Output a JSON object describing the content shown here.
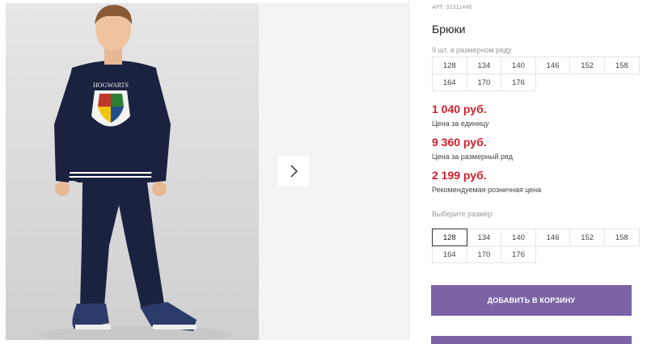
{
  "gallery": {
    "photo_alt": "",
    "sweatshirt_print": "HOGWARTS",
    "next_icon": "chevron-right-icon"
  },
  "product": {
    "article": "АРТ. 32311446",
    "title": "Брюки",
    "range_note": "9 шт. в размерном ряду",
    "range_sizes": [
      "128",
      "134",
      "140",
      "146",
      "152",
      "158",
      "164",
      "170",
      "176"
    ],
    "prices": [
      {
        "value": "1 040 руб.",
        "label": "Цена за единицу"
      },
      {
        "value": "9 360 руб.",
        "label": "Цена за размерный ряд"
      },
      {
        "value": "2 199 руб.",
        "label": "Рекомендуемая розничная цена"
      }
    ],
    "choose_label": "Выберите размер:",
    "selectable_sizes": [
      "128",
      "134",
      "140",
      "146",
      "152",
      "158",
      "164",
      "170",
      "176"
    ],
    "selected_size": "128",
    "add_to_cart": "ДОБАВИТЬ В КОРЗИНУ"
  },
  "colors": {
    "accent": "#7b63a5",
    "price": "#d21f2b",
    "sweatshirt": "#1b2240"
  }
}
